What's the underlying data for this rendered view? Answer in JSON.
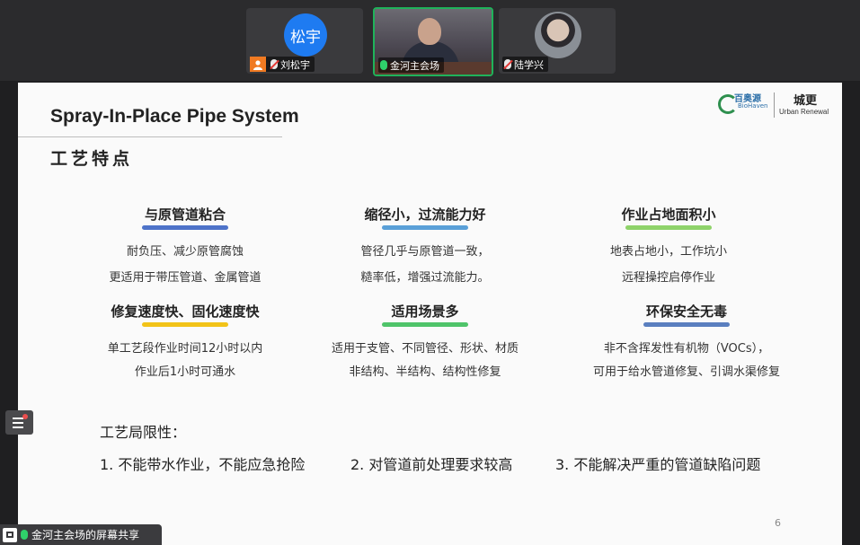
{
  "participants": [
    {
      "avatar_text": "松宇",
      "name": "刘松宇",
      "mic": "muted",
      "avatar_color": "#1e7bf1"
    },
    {
      "name": "金河主会场",
      "mic": "on",
      "active": true
    },
    {
      "name": "陆学兴",
      "mic": "muted"
    }
  ],
  "slide": {
    "title": "Spray-In-Place Pipe System",
    "subtitle": "工艺特点",
    "logo": {
      "brand_cn": "百奥源",
      "brand_en": "BioHaven",
      "partner_cn": "城更",
      "partner_en": "Urban Renewal"
    },
    "features": [
      {
        "title": "与原管道粘合",
        "lines": [
          "耐负压、减少原管腐蚀",
          "更适用于带压管道、金属管道"
        ],
        "bar_color": "#4e73c9"
      },
      {
        "title": "缩径小，过流能力好",
        "lines": [
          "管径几乎与原管道一致，",
          "糙率低，增强过流能力。"
        ],
        "bar_color": "#5aa0d8"
      },
      {
        "title": "作业占地面积小",
        "lines": [
          "地表占地小，工作坑小",
          "远程操控启停作业"
        ],
        "bar_color": "#8fd36a"
      },
      {
        "title": "修复速度快、固化速度快",
        "lines": [
          "单工艺段作业时间12小时以内",
          "作业后1小时可通水"
        ],
        "bar_color": "#f2c318"
      },
      {
        "title": "适用场景多",
        "lines": [
          "适用于支管、不同管径、形状、材质",
          "非结构、半结构、结构性修复"
        ],
        "bar_color": "#4fc46a"
      },
      {
        "title": "环保安全无毒",
        "lines": [
          "非不含挥发性有机物（VOCs），",
          "可用于给水管道修复、引调水渠修复"
        ],
        "bar_color": "#5a7fbf"
      }
    ],
    "limitations_label": "工艺局限性：",
    "limitations": [
      "1. 不能带水作业，不能应急抢险",
      "2. 对管道前处理要求较高",
      "3. 不能解决严重的管道缺陷问题"
    ],
    "page_number": "6"
  },
  "screen_share_label": "金河主会场的屏幕共享"
}
